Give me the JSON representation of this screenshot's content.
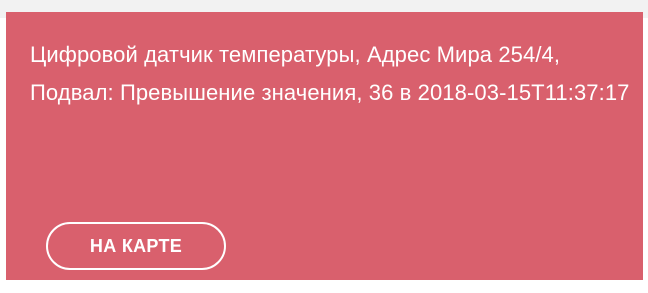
{
  "alert": {
    "message": "Цифровой датчик температуры, Адрес Мира 254/4, Подвал: Превышение значения, 36 в 2018-03-15T11:37:17",
    "button_label": "НА КАРТЕ",
    "background_color": "#d9606d",
    "text_color": "#ffffff"
  }
}
